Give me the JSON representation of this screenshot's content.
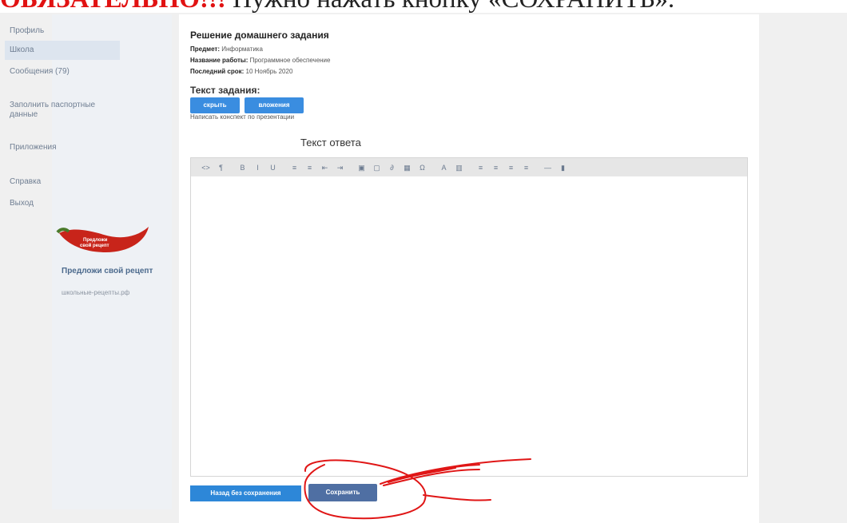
{
  "annotation": {
    "strong": "ОБЯЗАТЕЛЬНО!!!",
    "rest": " Нужно нажать кнопку «СОХРАНИТЬ».",
    "strong_color": "#e11212",
    "scribble_color": "#e01616"
  },
  "sidebar": {
    "items": [
      {
        "label": "Профиль"
      },
      {
        "label": "Школа",
        "active": true
      },
      {
        "label": "Сообщения (79)"
      },
      {
        "label": "Заполнить паспортные данные"
      },
      {
        "label": "Приложения"
      },
      {
        "label": "Справка"
      },
      {
        "label": "Выход"
      }
    ],
    "promo": {
      "badge": "Предложи свой рецепт",
      "title": "Предложи свой рецепт",
      "link": "школьные-рецепты.рф"
    }
  },
  "assignment": {
    "title": "Решение домашнего задания",
    "subject_label": "Предмет:",
    "subject": "Информатика",
    "work_label": "Название работы:",
    "work": "Программное обеспечение",
    "deadline_label": "Последний срок:",
    "deadline": "10 Ноябрь 2020",
    "task_header": "Текст задания:",
    "hide_button": "скрыть",
    "attachments_button": "вложения",
    "task_text": "Написать конспект по презентации"
  },
  "answer": {
    "title": "Текст ответа",
    "toolbar_icons": [
      "code-icon",
      "paragraph-icon",
      "bold-icon",
      "italic-icon",
      "underline-icon",
      "unordered-list-icon",
      "ordered-list-icon",
      "outdent-icon",
      "indent-icon",
      "image-icon",
      "video-icon",
      "link-icon",
      "table-icon",
      "special-char-icon",
      "font-color-icon",
      "background-color-icon",
      "align-left-icon",
      "align-center-icon",
      "align-right-icon",
      "justify-icon",
      "horizontal-rule-icon",
      "fullscreen-icon"
    ],
    "toolbar_glyphs": [
      "<>",
      "¶",
      "B",
      "I",
      "U",
      "≡",
      "≡",
      "⇤",
      "⇥",
      "▣",
      "▢",
      "∂",
      "▦",
      "Ω",
      "A",
      "▥",
      "≡",
      "≡",
      "≡",
      "≡",
      "—",
      "▮"
    ],
    "body": ""
  },
  "buttons": {
    "back": "Назад без сохранения",
    "save": "Сохранить"
  },
  "colors": {
    "accent_blue": "#3a8de0",
    "save_button": "#4f6fa3",
    "sidebar_bg": "#eef1f5"
  }
}
